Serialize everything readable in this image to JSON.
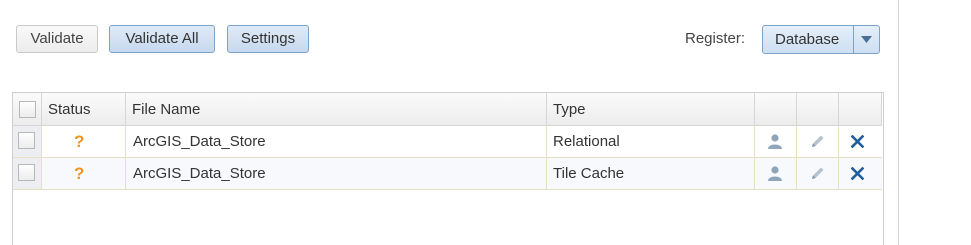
{
  "toolbar": {
    "validate_label": "Validate",
    "validate_all_label": "Validate All",
    "settings_label": "Settings"
  },
  "register": {
    "label": "Register:",
    "selected": "Database"
  },
  "table": {
    "columns": [
      "Status",
      "File Name",
      "Type"
    ],
    "rows": [
      {
        "status_icon": "question-mark-icon",
        "status": "?",
        "file_name": "ArcGIS_Data_Store",
        "type": "Relational"
      },
      {
        "status_icon": "question-mark-icon",
        "status": "?",
        "file_name": "ArcGIS_Data_Store",
        "type": "Tile Cache"
      }
    ]
  },
  "icons": {
    "user": "user-icon",
    "edit": "pencil-icon",
    "delete": "close-icon"
  },
  "colors": {
    "status_unknown": "#f0951e",
    "delete": "#1f5e9c",
    "button_blue": "#c6d9ef"
  }
}
